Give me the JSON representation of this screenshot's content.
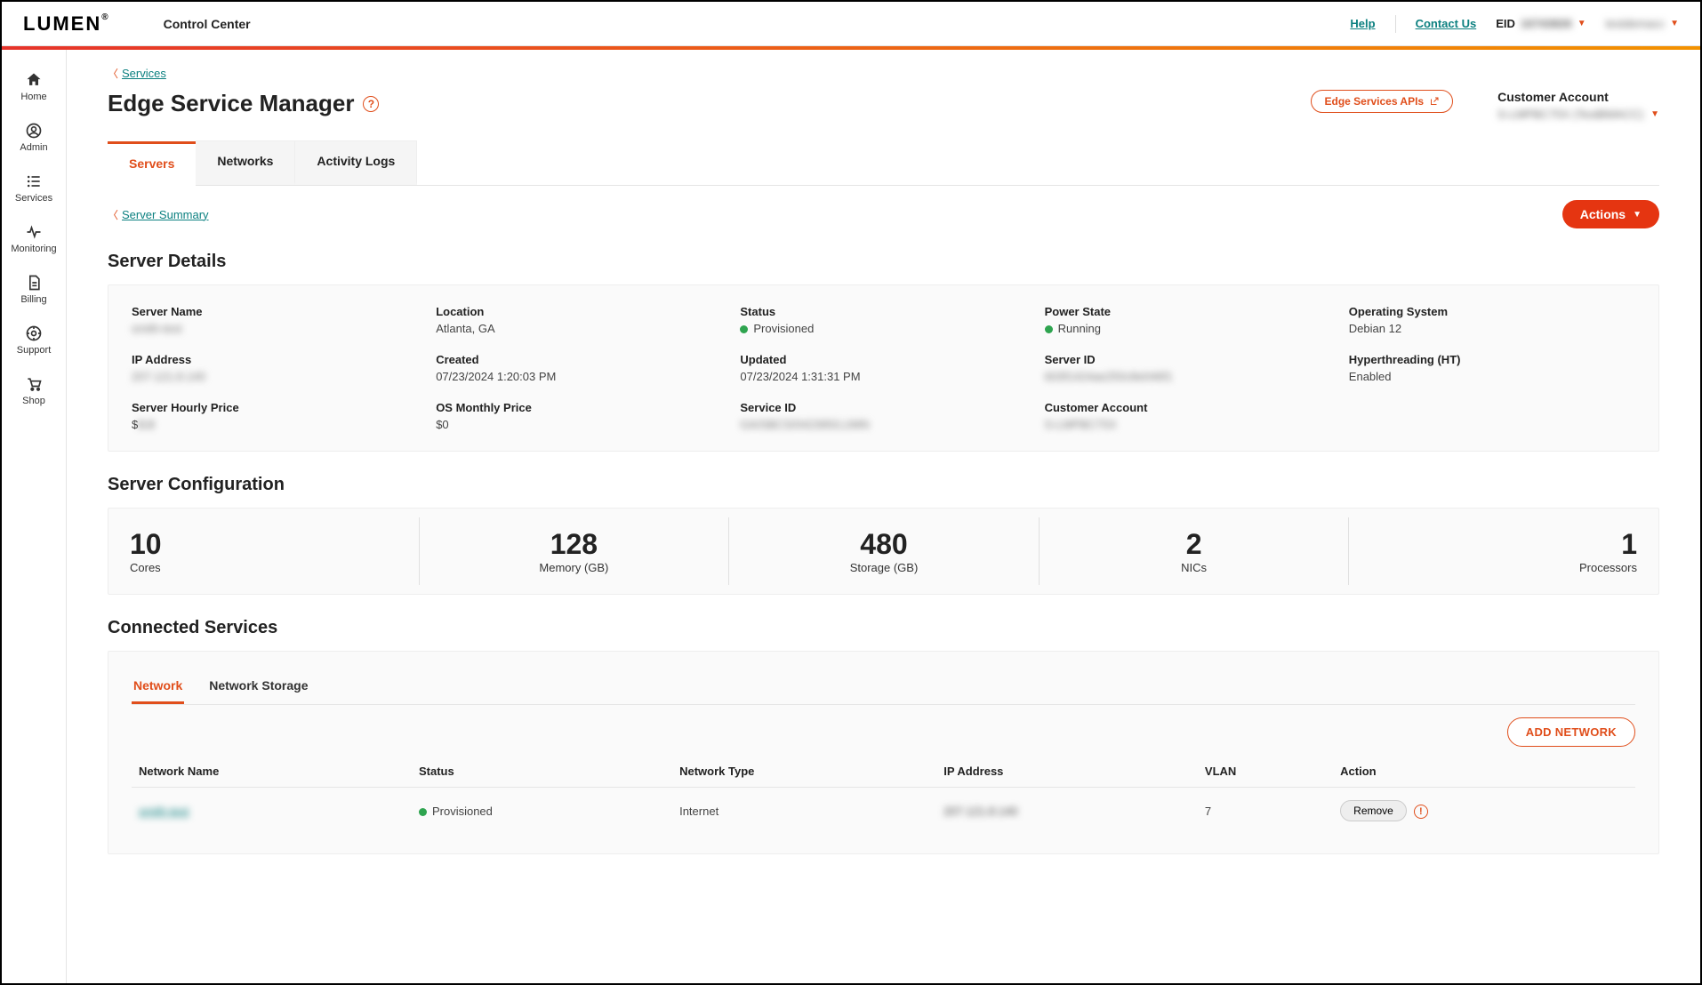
{
  "header": {
    "logo": "LUMEN",
    "logo_suffix": "®",
    "product": "Control Center",
    "help": "Help",
    "contact": "Contact Us",
    "eid_label": "EID",
    "eid_value": "16743826",
    "user_value": "testdemacc"
  },
  "sidebar": [
    {
      "label": "Home",
      "icon": "home-icon"
    },
    {
      "label": "Admin",
      "icon": "user-circle-icon"
    },
    {
      "label": "Services",
      "icon": "list-icon"
    },
    {
      "label": "Monitoring",
      "icon": "activity-icon"
    },
    {
      "label": "Billing",
      "icon": "file-icon"
    },
    {
      "label": "Support",
      "icon": "support-icon"
    },
    {
      "label": "Shop",
      "icon": "cart-icon"
    }
  ],
  "breadcrumb": {
    "services": "Services"
  },
  "page": {
    "title": "Edge Service Manager",
    "apis_btn": "Edge Services APIs",
    "cust_acct_label": "Customer Account",
    "cust_acct_value": "S-LMPBC75X (TestBMACC)"
  },
  "tabs": [
    "Servers",
    "Networks",
    "Activity Logs"
  ],
  "active_tab": 0,
  "sub_breadcrumb": "Server Summary",
  "actions_btn": "Actions",
  "sections": {
    "details_title": "Server Details",
    "config_title": "Server Configuration",
    "connected_title": "Connected Services"
  },
  "details": {
    "row1": [
      {
        "label": "Server Name",
        "value": "smith-test",
        "blur": true
      },
      {
        "label": "Location",
        "value": "Atlanta, GA"
      },
      {
        "label": "Status",
        "value": "Provisioned",
        "dot": "green"
      },
      {
        "label": "Power State",
        "value": "Running",
        "dot": "green"
      },
      {
        "label": "Operating System",
        "value": "Debian 12"
      }
    ],
    "row2": [
      {
        "label": "IP Address",
        "value": "207.121.8.140",
        "blur": true
      },
      {
        "label": "Created",
        "value": "07/23/2024 1:20:03 PM"
      },
      {
        "label": "Updated",
        "value": "07/23/2024 1:31:31 PM"
      },
      {
        "label": "Server ID",
        "value": "603f1424ae250c8e046f1",
        "blur": true
      },
      {
        "label": "Hyperthreading (HT)",
        "value": "Enabled"
      }
    ],
    "row3": [
      {
        "label": "Server Hourly Price",
        "value": "$0.0",
        "blur_partial": true
      },
      {
        "label": "OS Monthly Price",
        "value": "$0"
      },
      {
        "label": "Service ID",
        "value": "GA/SBCS/042395/LUMN",
        "blur": true
      },
      {
        "label": "Customer Account",
        "value": "S-LMPBC75X",
        "blur": true
      }
    ]
  },
  "config": [
    {
      "num": "10",
      "label": "Cores",
      "align": "left"
    },
    {
      "num": "128",
      "label": "Memory (GB)",
      "align": "center"
    },
    {
      "num": "480",
      "label": "Storage (GB)",
      "align": "center"
    },
    {
      "num": "2",
      "label": "NICs",
      "align": "center"
    },
    {
      "num": "1",
      "label": "Processors",
      "align": "right"
    }
  ],
  "inner_tabs": [
    "Network",
    "Network Storage"
  ],
  "inner_active": 0,
  "add_network_btn": "ADD NETWORK",
  "net_table": {
    "headers": [
      "Network Name",
      "Status",
      "Network Type",
      "IP Address",
      "VLAN",
      "Action"
    ],
    "rows": [
      {
        "name": "smith-test",
        "status": "Provisioned",
        "status_dot": "green",
        "type": "Internet",
        "ip": "207.121.8.140",
        "vlan": "7",
        "action": "Remove"
      }
    ]
  }
}
